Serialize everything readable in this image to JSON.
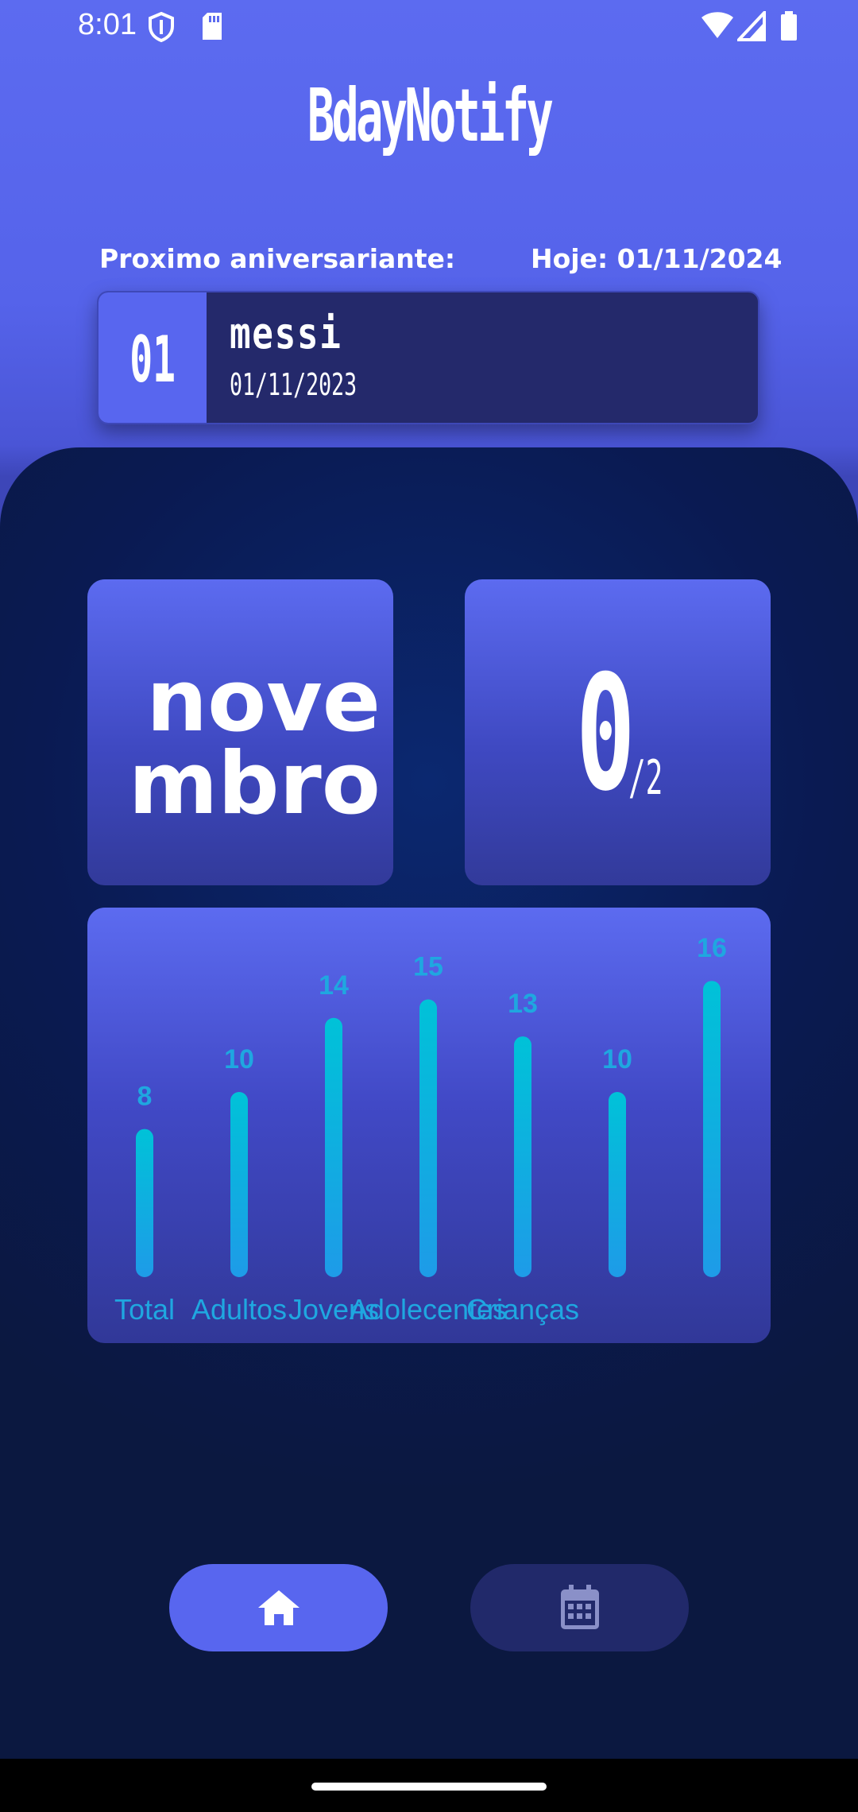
{
  "status_bar": {
    "time": "8:01"
  },
  "app": {
    "title": "BdayNotify"
  },
  "header": {
    "next_label": "Proximo aniversariante:",
    "today_label": "Hoje: 01/11/2024"
  },
  "next_birthday": {
    "day": "01",
    "name": "messi",
    "date": "01/11/2023"
  },
  "month_tile": {
    "month": "novembro"
  },
  "count_tile": {
    "count": "0",
    "total": "/2"
  },
  "chart_data": {
    "type": "bar",
    "categories": [
      "Total",
      "Adultos",
      "Jovens",
      "Adolecentes",
      "Crianças",
      "",
      ""
    ],
    "values": [
      8,
      10,
      14,
      15,
      13,
      10,
      16
    ],
    "ylim": [
      0,
      20
    ],
    "grid": false,
    "bar_color_top": "#00c2d8",
    "bar_color_bottom": "#1e9be8",
    "label_color": "#1fa7e0"
  },
  "nav": {
    "home_icon": "home-icon",
    "calendar_icon": "calendar-icon"
  },
  "colors": {
    "primary": "#5866ef",
    "dark_bg": "#0a1a52",
    "card_dark": "#24296b"
  }
}
